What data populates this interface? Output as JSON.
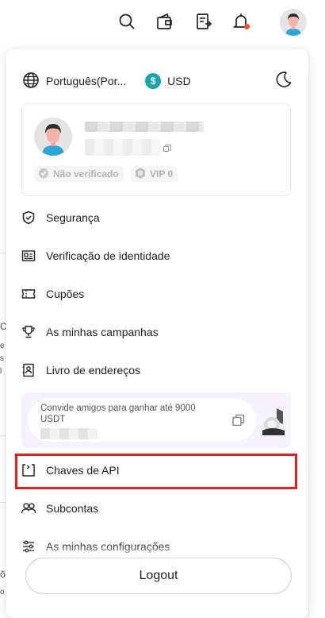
{
  "topbar": {
    "icons": [
      "search-icon",
      "wallet-icon",
      "orders-icon",
      "bell-icon",
      "avatar"
    ]
  },
  "background_fragments": [
    "C",
    "e",
    "s",
    "l",
    "õ",
    "o"
  ],
  "panel": {
    "language": "Português(Por...",
    "currency_symbol": "$",
    "currency": "USD",
    "profile": {
      "unverified_label": "Não verificado",
      "vip_label": "VIP 0"
    },
    "menu": [
      {
        "label": "Segurança",
        "icon": "shield-icon"
      },
      {
        "label": "Verificação de identidade",
        "icon": "id-card-icon"
      },
      {
        "label": "Cupões",
        "icon": "ticket-icon"
      },
      {
        "label": "As minhas campanhas",
        "icon": "trophy-icon"
      },
      {
        "label": "Livro de endereços",
        "icon": "address-book-icon"
      },
      {
        "label": "Chaves de API",
        "icon": "api-key-icon"
      },
      {
        "label": "Subcontas",
        "icon": "users-icon"
      },
      {
        "label": "As minhas configurações",
        "icon": "sliders-icon"
      }
    ],
    "invite": {
      "text": "Convide amigos para ganhar até 9000 USDT"
    },
    "logout_label": "Logout"
  },
  "colors": {
    "highlight": "#e02020",
    "currency_badge": "#1aa3a8",
    "invite_bg": "#f6f1ff",
    "notification": "#e8552e"
  }
}
